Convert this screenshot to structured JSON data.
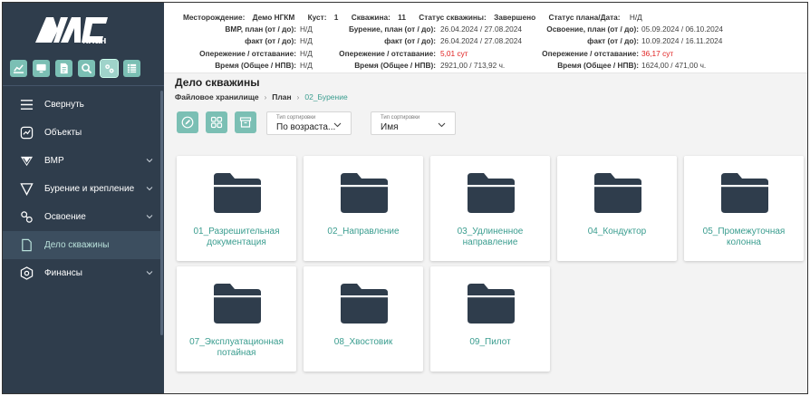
{
  "logo": {
    "subtitle": "план"
  },
  "sidebar": {
    "toolbar": [
      {
        "icon": "chart-icon"
      },
      {
        "icon": "monitor-icon"
      },
      {
        "icon": "document-icon"
      },
      {
        "icon": "search-icon"
      },
      {
        "icon": "gears-icon"
      },
      {
        "icon": "table-icon"
      }
    ],
    "items": [
      {
        "label": "Свернуть",
        "icon": "menu-icon"
      },
      {
        "label": "Объекты",
        "icon": "chart-icon"
      },
      {
        "label": "ВМР",
        "icon": "brand-icon",
        "expandable": true
      },
      {
        "label": "Бурение и крепление",
        "icon": "drill-icon",
        "expandable": true
      },
      {
        "label": "Освоение",
        "icon": "link-icon",
        "expandable": true
      },
      {
        "label": "Дело скважины",
        "icon": "file-icon",
        "active": true
      },
      {
        "label": "Финансы",
        "icon": "finance-icon",
        "expandable": true
      }
    ]
  },
  "info": {
    "top": {
      "field_label": "Месторождение:",
      "field_value": "Демо НГКМ",
      "pad_label": "Куст:",
      "pad_value": "1",
      "well_label": "Скважина:",
      "well_value": "11",
      "status_label": "Статус скважины:",
      "status_value": "Завершено",
      "plan_label": "Статус плана/Дата:",
      "plan_value": "Н/Д"
    },
    "col1": {
      "vmr_plan_label": "ВМР, план (от / до):",
      "vmr_plan_value": "Н/Д",
      "fact_label": "факт (от / до):",
      "fact_value": "Н/Д",
      "delta_label": "Опережение / отставание:",
      "delta_value": "Н/Д",
      "time_label": "Время (Общее / НПВ):",
      "time_value": "Н/Д"
    },
    "col2": {
      "drill_plan_label": "Бурение, план (от / до):",
      "drill_plan_value": "26.04.2024 / 27.08.2024",
      "fact_label": "факт (от / до):",
      "fact_value": "26.04.2024 / 27.08.2024",
      "delta_label": "Опережение / отставание:",
      "delta_value": "5,01 сут",
      "time_label": "Время (Общее / НПВ):",
      "time_value": "2921,00 / 713,92 ч."
    },
    "col3": {
      "dev_plan_label": "Освоение, план (от / до):",
      "dev_plan_value": "05.09.2024 / 06.10.2024",
      "fact_label": "факт (от / до):",
      "fact_value": "10.09.2024 / 16.11.2024",
      "delta_label": "Опережение / отставание:",
      "delta_value": "36,17 сут",
      "time_label": "Время (Общее / НПВ):",
      "time_value": "1624,00 / 471,00 ч."
    }
  },
  "main": {
    "title": "Дело скважины",
    "breadcrumb": [
      "Файловое хранилище",
      "План",
      "02_Бурение"
    ],
    "sort_type": {
      "label": "Тип сортировки",
      "value": "По возраста..."
    },
    "sort_field": {
      "label": "Тип сортировки",
      "value": "Имя"
    },
    "folders": [
      [
        "01_Разрешительная",
        "документация"
      ],
      [
        "02_Направление"
      ],
      [
        "03_Удлиненное",
        "направление"
      ],
      [
        "04_Кондуктор"
      ],
      [
        "05_Промежуточная",
        "колонна"
      ],
      [
        "07_Эксплуатационная",
        "потайная"
      ],
      [
        "08_Хвостовик"
      ],
      [
        "09_Пилот"
      ]
    ]
  },
  "colors": {
    "accent": "#7bbfb4",
    "sidebar": "#2f3d4c",
    "link": "#3a9d8f",
    "warning": "#e02020"
  }
}
